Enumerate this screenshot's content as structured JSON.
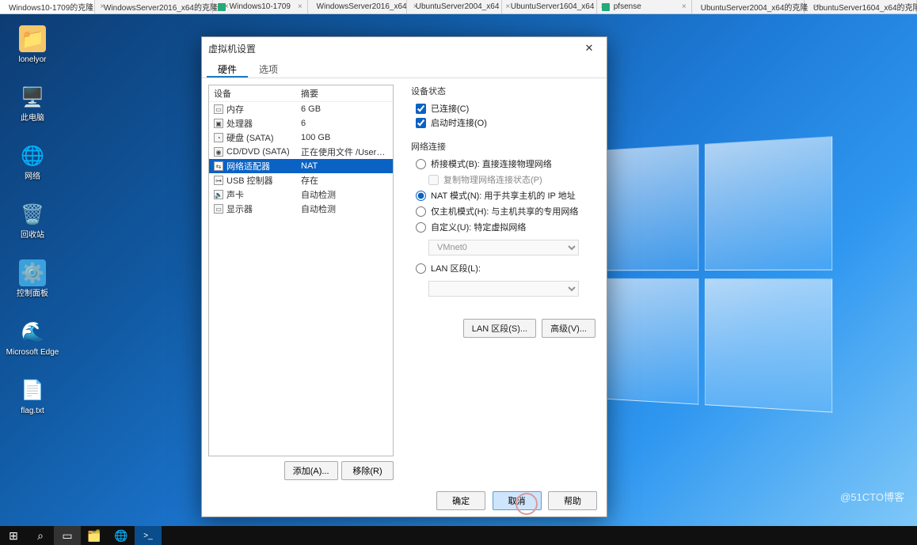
{
  "tabs": [
    {
      "label": "Windows10-1709的克隆",
      "active": true
    },
    {
      "label": "WindowsServer2016_x64的克隆"
    },
    {
      "label": "Windows10-1709"
    },
    {
      "label": "WindowsServer2016_x64"
    },
    {
      "label": "UbuntuServer2004_x64"
    },
    {
      "label": "UbuntuServer1604_x64"
    },
    {
      "label": "pfsense"
    },
    {
      "label": "UbuntuServer2004_x64的克隆",
      "orange": true
    },
    {
      "label": "UbuntuServer1604_x64的克隆",
      "orange": true
    }
  ],
  "desktop_icons": [
    {
      "name": "user-folder",
      "label": "lonelyor",
      "emoji": "📁",
      "bg": "#f5c66a"
    },
    {
      "name": "this-pc",
      "label": "此电脑",
      "emoji": "🖥️",
      "bg": "transparent"
    },
    {
      "name": "network",
      "label": "网络",
      "emoji": "🌐",
      "bg": "transparent"
    },
    {
      "name": "recycle-bin",
      "label": "回收站",
      "emoji": "🗑️",
      "bg": "transparent"
    },
    {
      "name": "control-panel",
      "label": "控制面板",
      "emoji": "⚙️",
      "bg": "#3aa1dd"
    },
    {
      "name": "edge",
      "label": "Microsoft Edge",
      "emoji": "🌊",
      "bg": "transparent"
    },
    {
      "name": "flag-file",
      "label": "flag.txt",
      "emoji": "📄",
      "bg": "transparent"
    }
  ],
  "dialog": {
    "title": "虚拟机设置",
    "tab_hw": "硬件",
    "tab_opt": "选项",
    "col_device": "设备",
    "col_summary": "摘要",
    "devices": [
      {
        "ic": "▭",
        "name": "内存",
        "val": "6 GB"
      },
      {
        "ic": "▣",
        "name": "处理器",
        "val": "6"
      },
      {
        "ic": "◔",
        "name": "硬盘 (SATA)",
        "val": "100 GB"
      },
      {
        "ic": "◉",
        "name": "CD/DVD (SATA)",
        "val": "正在使用文件 /Users/robert/D..."
      },
      {
        "ic": "⇆",
        "name": "网络适配器",
        "val": "NAT",
        "sel": true
      },
      {
        "ic": "⊶",
        "name": "USB 控制器",
        "val": "存在"
      },
      {
        "ic": "🔈",
        "name": "声卡",
        "val": "自动检测"
      },
      {
        "ic": "▭",
        "name": "显示器",
        "val": "自动检测"
      }
    ],
    "btn_add": "添加(A)...",
    "btn_remove": "移除(R)",
    "grp_state": "设备状态",
    "chk_connected": "已连接(C)",
    "chk_connect_on": "启动时连接(O)",
    "grp_net": "网络连接",
    "rad_bridge": "桥接模式(B): 直接连接物理网络",
    "chk_replicate": "复制物理网络连接状态(P)",
    "rad_nat": "NAT 模式(N): 用于共享主机的 IP 地址",
    "rad_host": "仅主机模式(H): 与主机共享的专用网络",
    "rad_custom": "自定义(U): 特定虚拟网络",
    "sel_vmnet": "VMnet0",
    "rad_lan": "LAN 区段(L):",
    "btn_lanseg": "LAN 区段(S)...",
    "btn_adv": "高级(V)...",
    "btn_ok": "确定",
    "btn_cancel": "取消",
    "btn_help": "帮助"
  },
  "watermark": "@51CTO博客"
}
